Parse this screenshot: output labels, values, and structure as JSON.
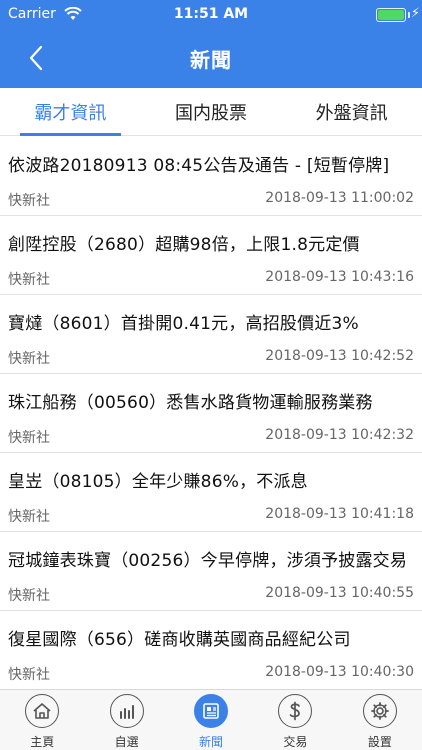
{
  "status_bar": {
    "carrier": "Carrier",
    "time": "11:51 AM"
  },
  "nav": {
    "title": "新聞"
  },
  "tabs": [
    {
      "label": "霸才資訊",
      "active": true
    },
    {
      "label": "国内股票",
      "active": false
    },
    {
      "label": "外盤資訊",
      "active": false
    }
  ],
  "news": [
    {
      "title": "依波路20180913 08:45公告及通告 - [短暫停牌]",
      "source": "快新社",
      "time": "2018-09-13 11:00:02"
    },
    {
      "title": "創陞控股（2680）超購98倍，上限1.8元定價",
      "source": "快新社",
      "time": "2018-09-13 10:43:16"
    },
    {
      "title": "寶燵（8601）首掛開0.41元，高招股價近3%",
      "source": "快新社",
      "time": "2018-09-13 10:42:52"
    },
    {
      "title": "珠江船務（00560）悉售水路貨物運輸服務業務",
      "source": "快新社",
      "time": "2018-09-13 10:42:32"
    },
    {
      "title": "皇岦（08105）全年少賺86%，不派息",
      "source": "快新社",
      "time": "2018-09-13 10:41:18"
    },
    {
      "title": "冠城鐘表珠寶（00256）今早停牌，涉須予披露交易",
      "source": "快新社",
      "time": "2018-09-13 10:40:55"
    },
    {
      "title": "復星國際（656）磋商收購英國商品經紀公司",
      "source": "快新社",
      "time": "2018-09-13 10:40:30"
    }
  ],
  "tabbar": [
    {
      "label": "主頁",
      "icon": "home-icon",
      "active": false
    },
    {
      "label": "自選",
      "icon": "chart-icon",
      "active": false
    },
    {
      "label": "新聞",
      "icon": "news-icon",
      "active": true
    },
    {
      "label": "交易",
      "icon": "dollar-icon",
      "active": false
    },
    {
      "label": "設置",
      "icon": "gear-icon",
      "active": false
    }
  ],
  "colors": {
    "primary": "#3b82e8",
    "battery": "#4cd964"
  }
}
